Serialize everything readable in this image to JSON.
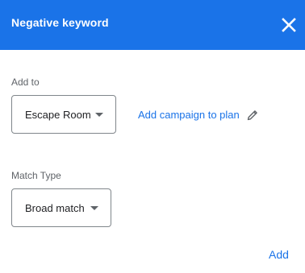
{
  "dialog": {
    "title": "Negative keyword",
    "close_icon": "close-icon"
  },
  "add_to": {
    "label": "Add to",
    "selected": "Escape Room",
    "link_label": "Add campaign to plan",
    "link_icon": "pencil-icon"
  },
  "match_type": {
    "label": "Match Type",
    "selected": "Broad match"
  },
  "actions": {
    "add_label": "Add"
  },
  "colors": {
    "header": "#1a73e8",
    "accent": "#1a73e8"
  }
}
